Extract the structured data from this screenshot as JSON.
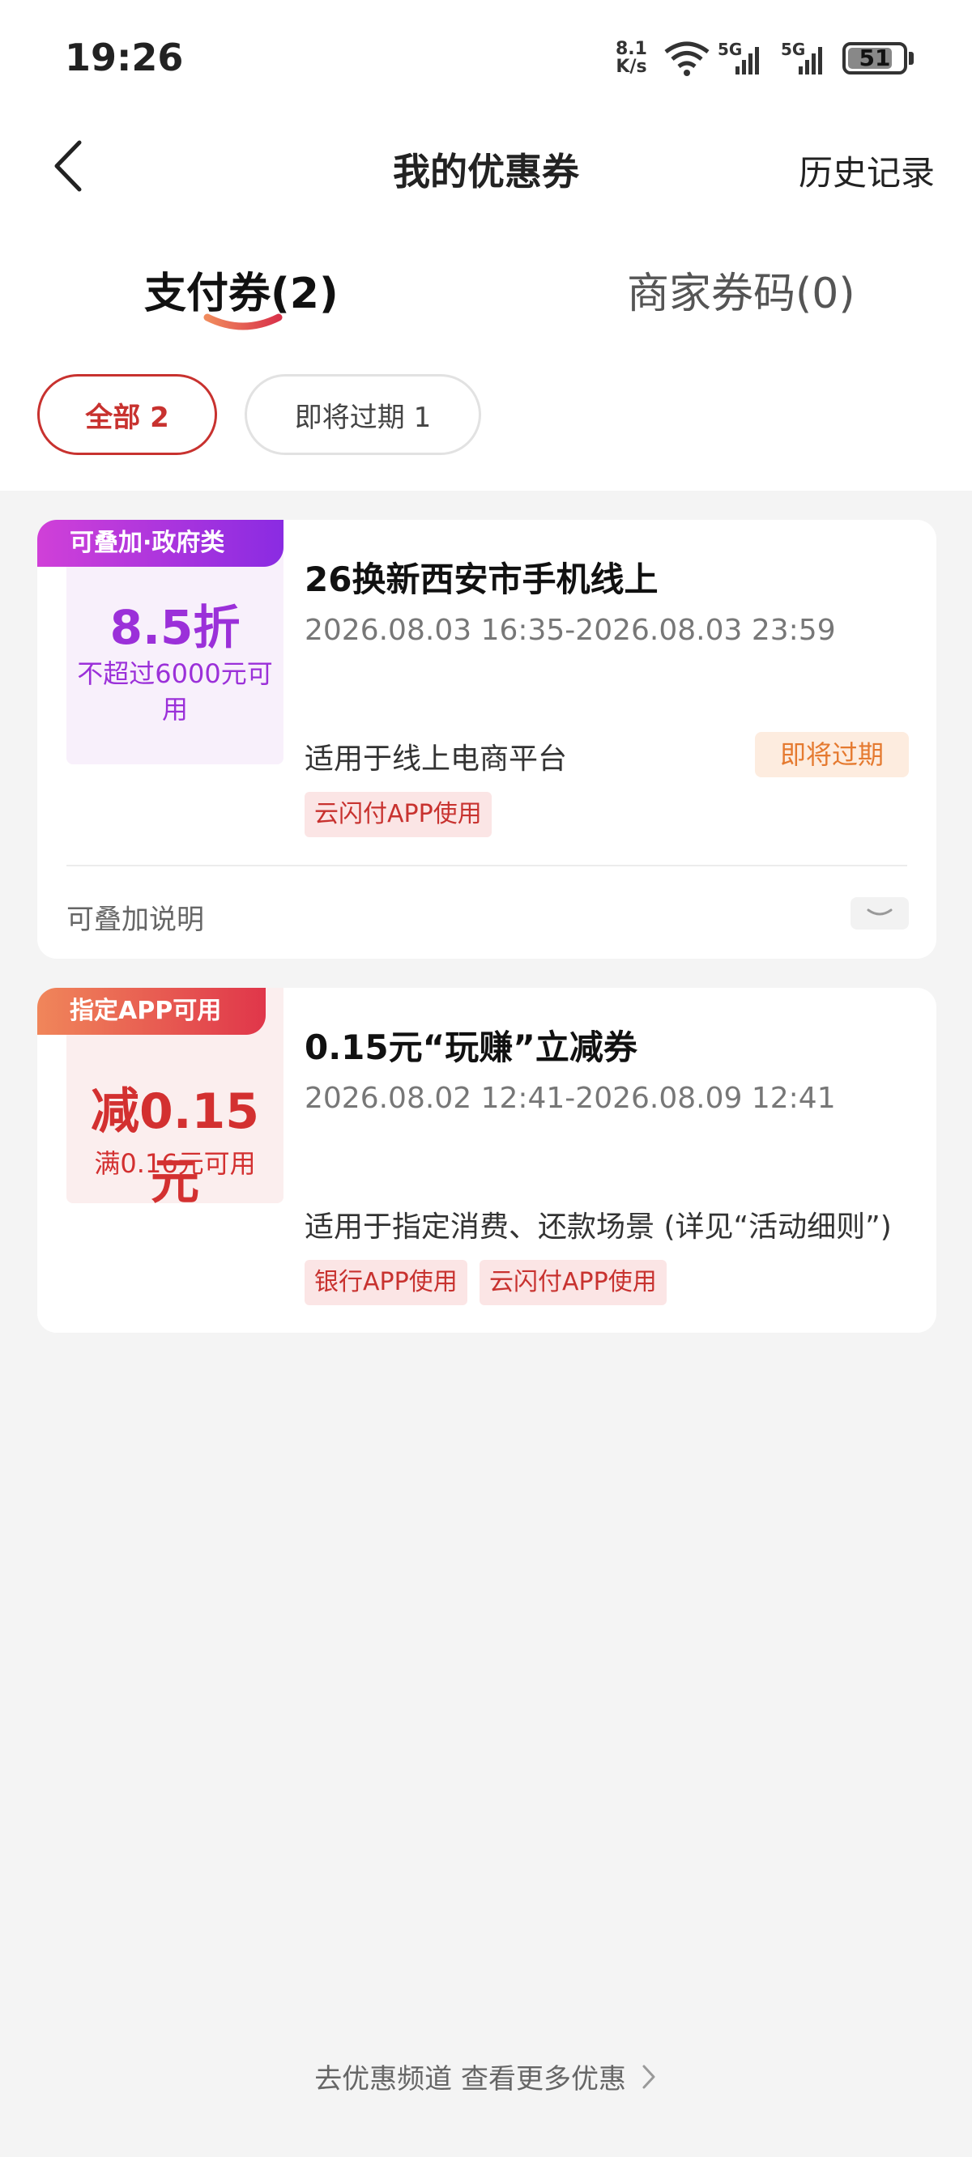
{
  "status_bar": {
    "time": "19:26",
    "speed_value": "8.1",
    "speed_unit": "K/s",
    "sim1": "5G",
    "sim2": "5G",
    "battery": "51"
  },
  "nav": {
    "title": "我的优惠券",
    "history_label": "历史记录"
  },
  "tabs": [
    {
      "label": "支付券(2)",
      "active": true
    },
    {
      "label": "商家券码(0)",
      "active": false
    }
  ],
  "filters": [
    {
      "label": "全部 2",
      "active": true
    },
    {
      "label": "即将过期 1",
      "active": false
    }
  ],
  "coupons": [
    {
      "badge": "可叠加·政府类",
      "value": "8.5折",
      "condition": "不超过6000元可用",
      "title": "26换新西安市手机线上",
      "validity": "2026.08.03 16:35-2026.08.03 23:59",
      "scope": "适用于线上电商平台",
      "status": "即将过期",
      "tags": [
        "云闪付APP使用"
      ],
      "stack_note": "可叠加说明"
    },
    {
      "badge": "指定APP可用",
      "value": "减0.15元",
      "condition": "满0.16元可用",
      "title": "0.15元“玩赚”立减券",
      "validity": "2026.08.02 12:41-2026.08.09 12:41",
      "scope": "适用于指定消费、还款场景 (详见“活动细则”)",
      "tags": [
        "银行APP使用",
        "云闪付APP使用"
      ]
    }
  ],
  "footer": {
    "link_label": "去优惠频道 查看更多优惠"
  },
  "colors": {
    "accent_red": "#c8322f",
    "purple": "#9b30d9",
    "orange": "#e57a30"
  }
}
